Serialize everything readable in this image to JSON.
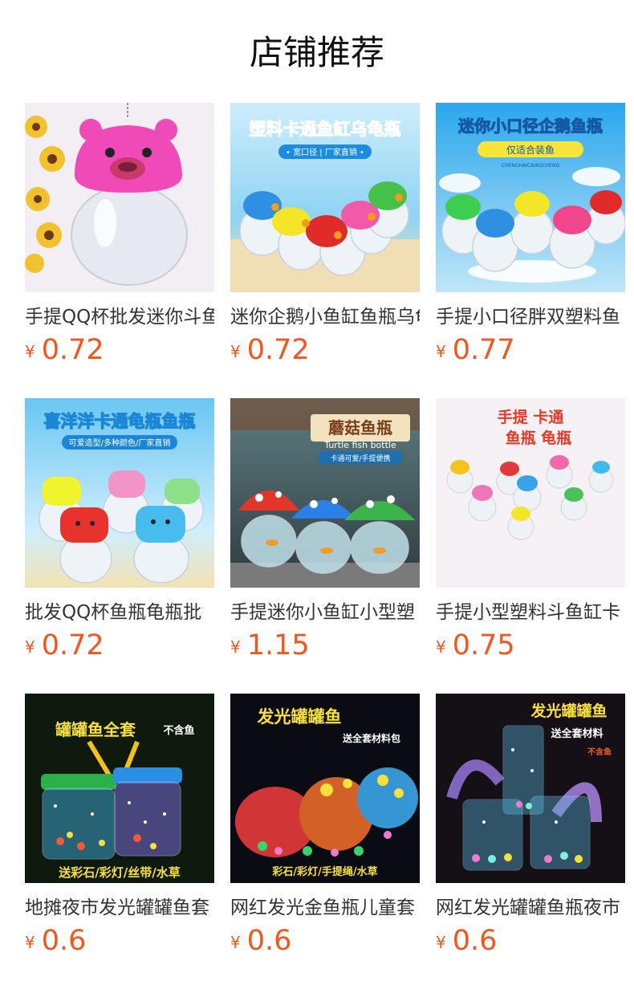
{
  "header": {
    "title": "店铺推荐"
  },
  "currency_symbol": "¥",
  "colors": {
    "price": "#f1561c",
    "title": "#111111",
    "text": "#333333"
  },
  "products": [
    {
      "name": "手提QQ杯批发迷你斗鱼",
      "price": "0.72",
      "image": {
        "icon": "pink-bear-jar-icon"
      }
    },
    {
      "name": "迷你企鹅小鱼缸鱼瓶乌龟",
      "price": "0.72",
      "image": {
        "icon": "cartoon-fish-jars-icon",
        "banner": "塑料卡通鱼缸乌龟瓶",
        "tag": "• 宽口径 | 厂家直销 •"
      }
    },
    {
      "name": "手提小口径胖双塑料鱼",
      "price": "0.77",
      "image": {
        "icon": "penguin-jars-icon",
        "banner": "迷你小口径企鹅鱼瓶",
        "tag": "仅适合装鱼",
        "sub": "CHENGHAICAIXUCHENG"
      }
    },
    {
      "name": "批发QQ杯鱼瓶龟瓶批",
      "price": "0.72",
      "image": {
        "icon": "xiyangyang-jars-icon",
        "banner": "喜洋洋卡通龟瓶鱼瓶",
        "tag": "可爱造型/多种颜色/厂家直销"
      }
    },
    {
      "name": "手提迷你小鱼缸小型塑",
      "price": "1.15",
      "image": {
        "icon": "mushroom-fish-bottle-icon",
        "banner": "蘑菇鱼瓶",
        "sub": "Turtle fish bottle",
        "tag": "卡通可爱/手提便携"
      }
    },
    {
      "name": "手提小型塑料斗鱼缸卡",
      "price": "0.75",
      "image": {
        "icon": "mini-cartoon-jars-icon",
        "banner": "手提 卡通",
        "banner2": "鱼瓶  龟瓶"
      }
    },
    {
      "name": "地摊夜市发光罐罐鱼套",
      "price": "0.6",
      "image": {
        "icon": "glowing-jar-set-icon",
        "banner": "罐罐鱼全套",
        "tag": "不含鱼",
        "sub": "送彩石/彩灯/丝带/水草"
      }
    },
    {
      "name": "网红发光金鱼瓶儿童套",
      "price": "0.6",
      "image": {
        "icon": "glowing-goldfish-bowl-icon",
        "banner": "发光罐罐鱼",
        "tag": "送全套材料包",
        "sub": "彩石/彩灯/手提绳/水草"
      }
    },
    {
      "name": "网红发光罐罐鱼瓶夜市",
      "price": "0.6",
      "image": {
        "icon": "glowing-ribbon-jars-icon",
        "banner": "发光罐罐鱼",
        "tag": "送全套材料",
        "sub": "不含鱼"
      }
    }
  ]
}
